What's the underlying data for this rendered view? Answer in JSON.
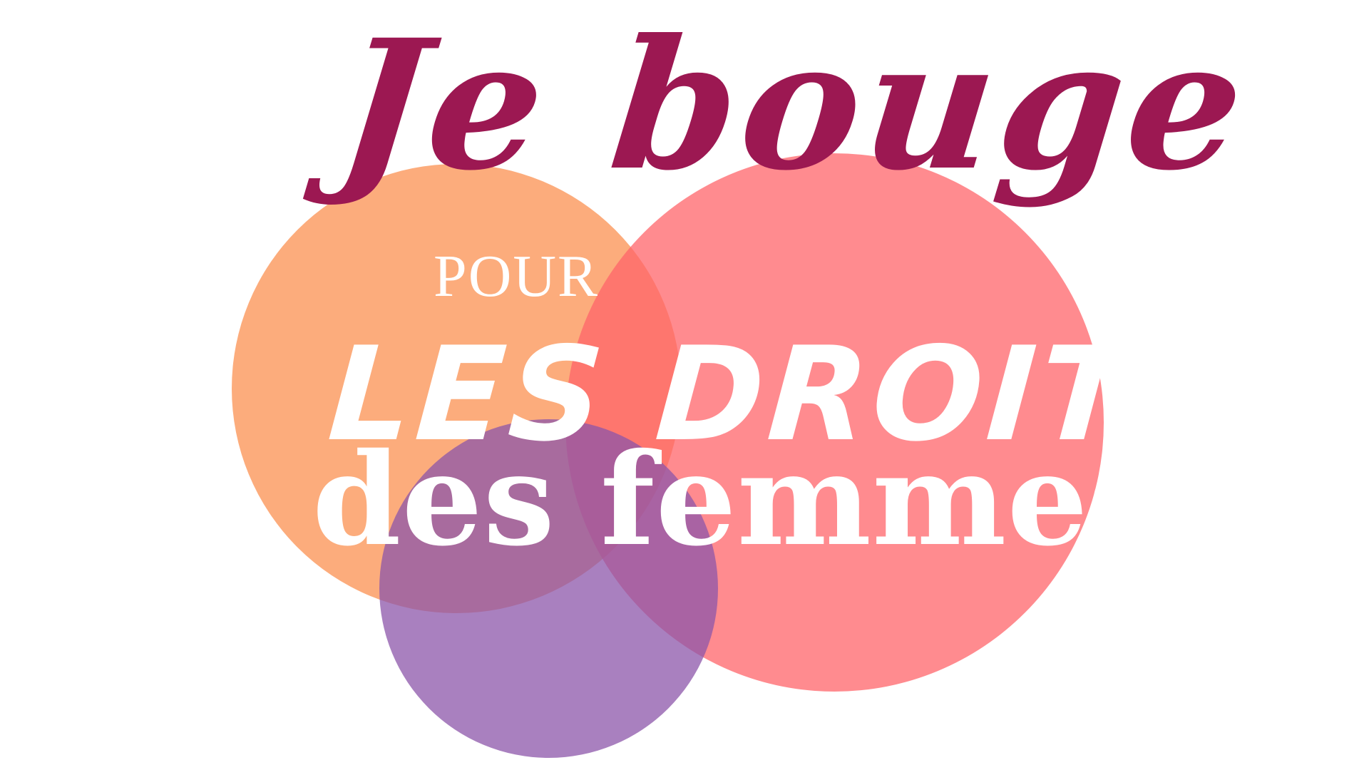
{
  "colors": {
    "background": "#ffffff",
    "circle_orange": "rgba(252, 160, 106, 0.88)",
    "circle_coral": "rgba(255, 100, 105, 0.75)",
    "circle_purple": "rgba(140, 85, 170, 0.75)",
    "title": "#9c1852",
    "white_text": "#ffffff"
  },
  "poster": {
    "title": "Je bouge",
    "subtitle_small": "POUR",
    "subtitle_large": "LES DROITS",
    "subtitle_bottom": "des femmes"
  }
}
